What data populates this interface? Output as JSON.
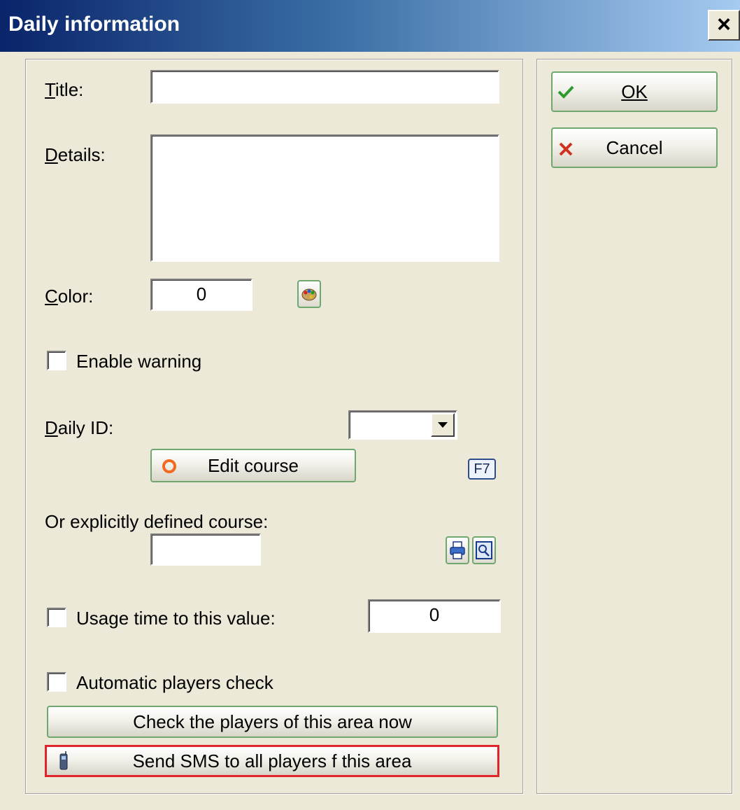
{
  "window": {
    "title": "Daily information",
    "close_label": "×"
  },
  "form": {
    "title_label": "Title:",
    "title_value": "",
    "details_label": "Details:",
    "details_value": "",
    "color_label": "Color:",
    "color_value": "0",
    "enable_warning_label": "Enable warning",
    "enable_warning_checked": false,
    "daily_id_label": "Daily ID:",
    "daily_id_value": "",
    "edit_course_label": "Edit course",
    "edit_course_shortcut": "F7",
    "explicit_course_label": "Or explicitly defined course:",
    "explicit_course_value": "",
    "usage_time_label": "Usage time to this value:",
    "usage_time_checked": false,
    "usage_time_value": "0",
    "auto_check_label": "Automatic players check",
    "auto_check_checked": false,
    "check_now_label": "Check the players of this area now",
    "send_sms_label": "Send SMS to all players f this area"
  },
  "actions": {
    "ok_label": "OK",
    "cancel_label": "Cancel"
  },
  "colors": {
    "highlight_border": "#E0242C",
    "button_border": "#6FA86F",
    "ok_check": "#2E9A2E",
    "cancel_x": "#D03020"
  },
  "icons": [
    "close-icon",
    "scroll-up-icon",
    "scroll-down-icon",
    "color-palette-icon",
    "dropdown-arrow-icon",
    "edit-course-icon",
    "print-icon",
    "search-icon",
    "phone-icon",
    "checkmark-icon",
    "x-icon"
  ]
}
